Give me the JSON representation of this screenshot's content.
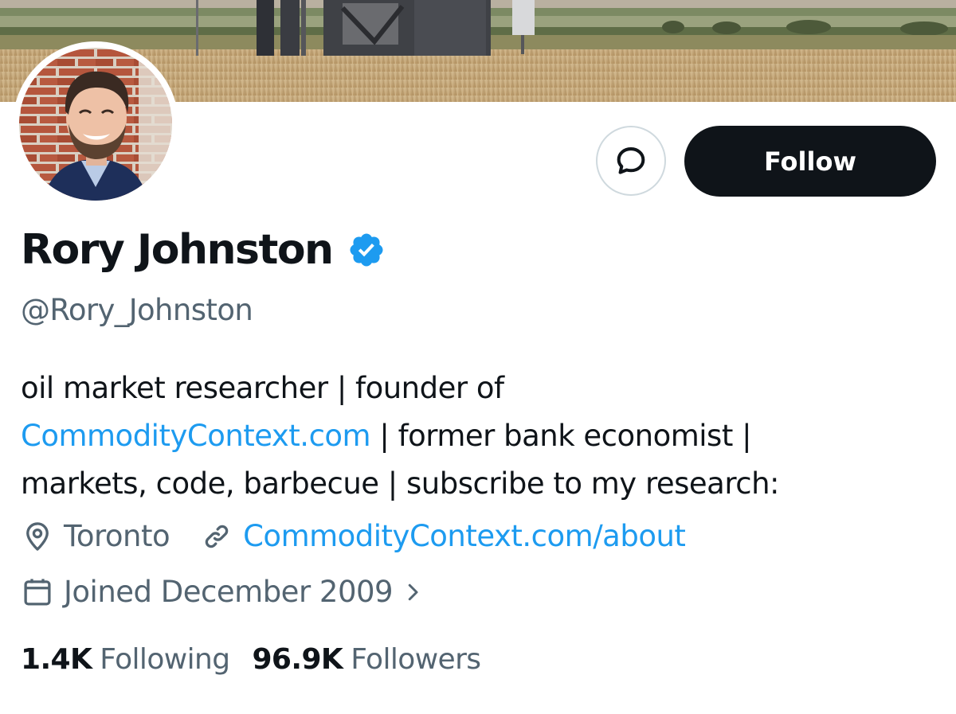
{
  "profile": {
    "display_name": "Rory Johnston",
    "handle": "@Rory_Johnston",
    "verified_icon": "verified-badge-icon",
    "bio": {
      "line1": "oil market researcher | founder of",
      "line2_link": "CommodityContext.com",
      "line2_rest": " | former bank economist |",
      "line3": "markets, code, barbecue | subscribe to my research:"
    },
    "location": "Toronto",
    "website": "CommodityContext.com/about",
    "joined": "Joined December 2009"
  },
  "actions": {
    "follow_label": "Follow",
    "message_icon": "message-bubble-icon"
  },
  "stats": {
    "following_count": "1.4K",
    "following_label": "Following",
    "followers_count": "96.9K",
    "followers_label": "Followers"
  },
  "colors": {
    "text_primary": "#0f1419",
    "text_secondary": "#536471",
    "link": "#1d9bf0",
    "verified": "#1d9bf0",
    "button_dark": "#0f1419",
    "border": "#cfd9de"
  }
}
